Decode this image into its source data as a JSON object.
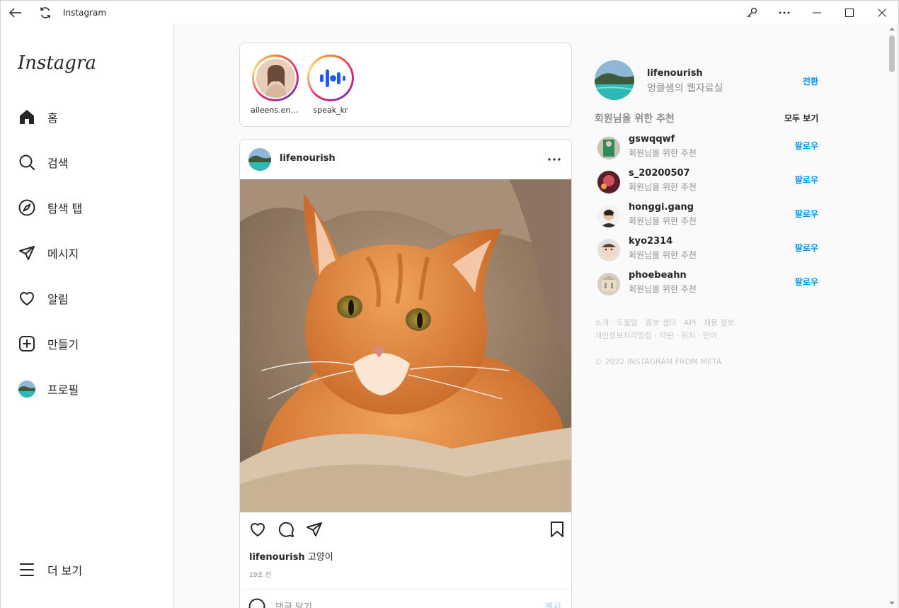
{
  "window": {
    "title": "Instagram"
  },
  "sidebar": {
    "logo_text": "Instagram",
    "items": [
      {
        "label": "홈",
        "icon": "home-icon"
      },
      {
        "label": "검색",
        "icon": "search-icon"
      },
      {
        "label": "탐색 탭",
        "icon": "compass-icon"
      },
      {
        "label": "메시지",
        "icon": "send-icon"
      },
      {
        "label": "알림",
        "icon": "heart-icon"
      },
      {
        "label": "만들기",
        "icon": "plus-square-icon"
      },
      {
        "label": "프로필",
        "icon": "avatar"
      }
    ],
    "more_label": "더 보기"
  },
  "stories": [
    {
      "name": "aileens.enq..."
    },
    {
      "name": "speak_kr"
    }
  ],
  "post": {
    "username": "lifenourish",
    "caption_user": "lifenourish",
    "caption_text": "고양이",
    "time": "19초 전",
    "comment_placeholder": "댓글 달기...",
    "comment_post": "게시"
  },
  "profile": {
    "username": "lifenourish",
    "name": "엉클샘의 웹자료실",
    "switch_label": "전환"
  },
  "suggestions": {
    "title": "회원님을 위한 추천",
    "see_all": "모두 보기",
    "items": [
      {
        "username": "gswqqwf",
        "sub": "회원님을 위한 추천",
        "action": "팔로우"
      },
      {
        "username": "s_20200507",
        "sub": "회원님을 위한 추천",
        "action": "팔로우"
      },
      {
        "username": "honggi.gang",
        "sub": "회원님을 위한 추천",
        "action": "팔로우"
      },
      {
        "username": "kyo2314",
        "sub": "회원님을 위한 추천",
        "action": "팔로우"
      },
      {
        "username": "phoebeahn",
        "sub": "회원님을 위한 추천",
        "action": "팔로우"
      }
    ]
  },
  "footer": {
    "links_line1": "소개 · 도움말 · 홍보 센터 · API · 채용 정보 ·",
    "links_line2": "개인정보처리방침 · 약관 · 위치 · 언어",
    "copyright": "© 2022 INSTAGRAM FROM META"
  },
  "colors": {
    "accent": "#0095f6",
    "text": "#262626",
    "muted": "#8e8e8e",
    "border": "#dbdbdb"
  }
}
